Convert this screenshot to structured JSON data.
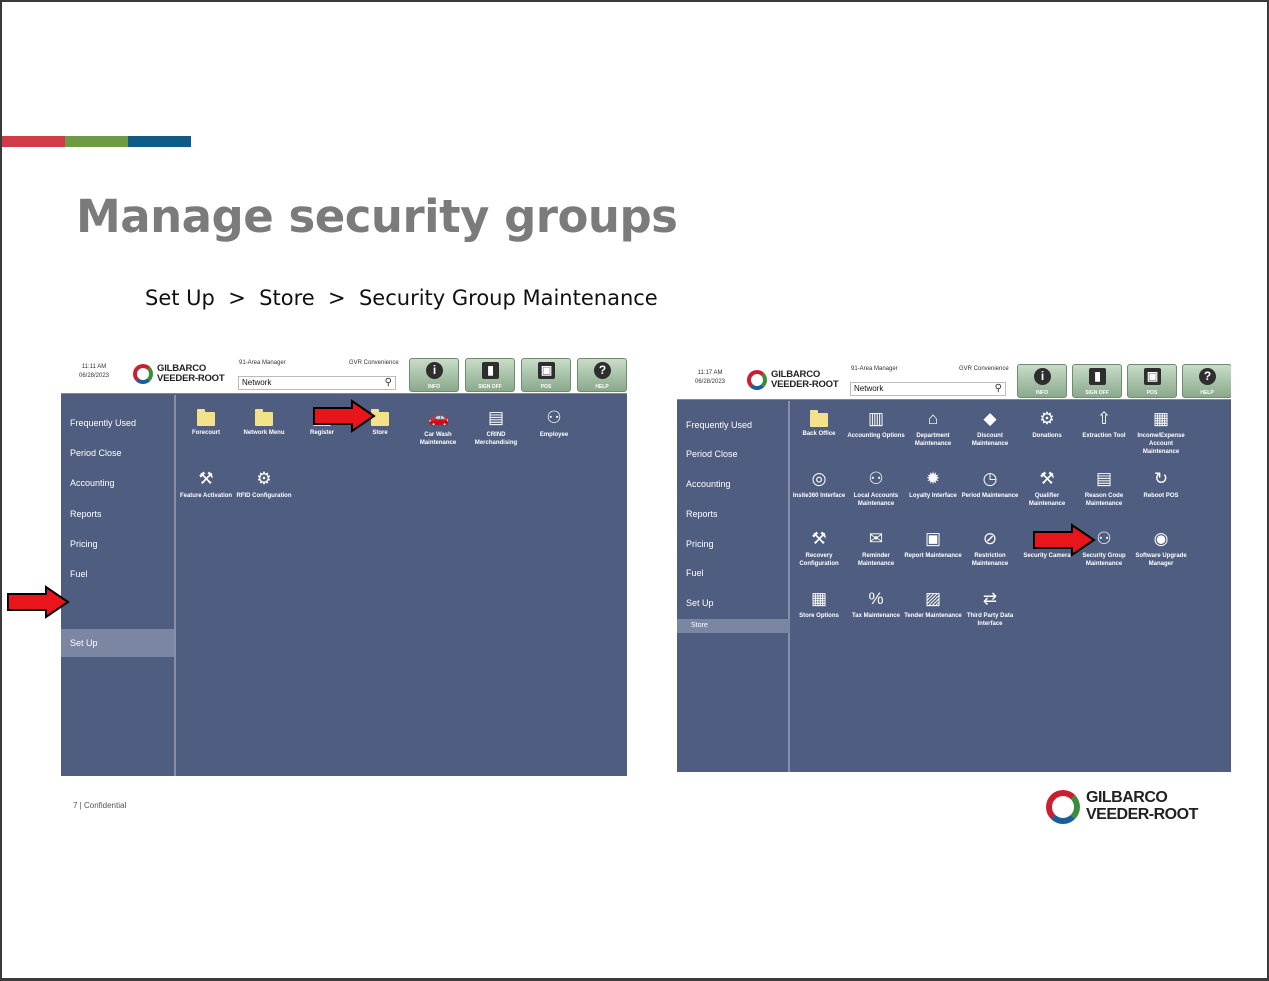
{
  "slide": {
    "title": "Manage security groups",
    "path": "Set Up  >  Store  >  Security Group Maintenance",
    "footer": "7 | Confidential",
    "stripe_colors": [
      "#d13b47",
      "#6f9a45",
      "#0f5b86"
    ],
    "brand_logo": "GILBARCO VEEDER-ROOT"
  },
  "left_screen": {
    "time": "11:11 AM",
    "date": "06/28/2023",
    "logo_line1": "GILBARCO",
    "logo_line2": "VEEDER-ROOT",
    "manager": "91-Area Manager",
    "store_name": "GVR Convenience",
    "search_value": "Network",
    "buttons": [
      "INFO",
      "SIGN OFF",
      "POS",
      "HELP"
    ],
    "sidebar": [
      "Frequently Used",
      "Period Close",
      "Accounting",
      "Reports",
      "Pricing",
      "Fuel",
      "Set Up"
    ],
    "selected": "Set Up",
    "tiles": [
      {
        "label": "Forecourt",
        "icon": "folder-icon"
      },
      {
        "label": "Network Menu",
        "icon": "folder-icon"
      },
      {
        "label": "Register",
        "icon": "folder-icon"
      },
      {
        "label": "Store",
        "icon": "folder-icon"
      },
      {
        "label": "Car Wash Maintenance",
        "icon": "car-icon"
      },
      {
        "label": "CRIND Merchandising",
        "icon": "crind-icon"
      },
      {
        "label": "Employee",
        "icon": "people-icon"
      },
      {
        "label": "Feature Activation",
        "icon": "wrench-icon"
      },
      {
        "label": "RFID Configuration",
        "icon": "gear-icon"
      }
    ]
  },
  "right_screen": {
    "time": "11:17 AM",
    "date": "06/28/2023",
    "logo_line1": "GILBARCO",
    "logo_line2": "VEEDER-ROOT",
    "manager": "91-Area Manager",
    "store_name": "GVR Convenience",
    "search_value": "Network",
    "buttons": [
      "INFO",
      "SIGN OFF",
      "POS",
      "HELP"
    ],
    "sidebar": [
      "Frequently Used",
      "Period Close",
      "Accounting",
      "Reports",
      "Pricing",
      "Fuel",
      "Set Up"
    ],
    "sub_selected": "Store",
    "tiles": [
      {
        "label": "Back Office",
        "icon": "folder-icon"
      },
      {
        "label": "Accounting Options",
        "icon": "ledger-icon"
      },
      {
        "label": "Department Maintenance",
        "icon": "building-icon"
      },
      {
        "label": "Discount Maintenance",
        "icon": "tag-icon"
      },
      {
        "label": "Donations",
        "icon": "gear-icon"
      },
      {
        "label": "Extraction Tool",
        "icon": "extract-icon"
      },
      {
        "label": "Income/Expense Account Maintenance",
        "icon": "account-icon"
      },
      {
        "label": "Insite360 Interface",
        "icon": "globe-icon"
      },
      {
        "label": "Local Accounts Maintenance",
        "icon": "people-icon"
      },
      {
        "label": "Loyalty Interface",
        "icon": "badge-icon"
      },
      {
        "label": "Period Maintenance",
        "icon": "clock-icon"
      },
      {
        "label": "Qualifier Maintenance",
        "icon": "wrench-icon"
      },
      {
        "label": "Reason Code Maintenance",
        "icon": "document-icon"
      },
      {
        "label": "Reboot POS",
        "icon": "refresh-icon"
      },
      {
        "label": "Recovery Configuration",
        "icon": "wrench-icon"
      },
      {
        "label": "Reminder Maintenance",
        "icon": "reminder-icon"
      },
      {
        "label": "Report Maintenance",
        "icon": "report-icon"
      },
      {
        "label": "Restriction Maintenance",
        "icon": "no-icon"
      },
      {
        "label": "Security Camera",
        "icon": "camera-icon"
      },
      {
        "label": "Security Group Maintenance",
        "icon": "people-icon"
      },
      {
        "label": "Software Upgrade Manager",
        "icon": "disc-icon"
      },
      {
        "label": "Store Options",
        "icon": "store-icon"
      },
      {
        "label": "Tax Maintenance",
        "icon": "percent-icon"
      },
      {
        "label": "Tender Maintenance",
        "icon": "money-icon"
      },
      {
        "label": "Third Party Data Interface",
        "icon": "exchange-icon"
      }
    ]
  }
}
